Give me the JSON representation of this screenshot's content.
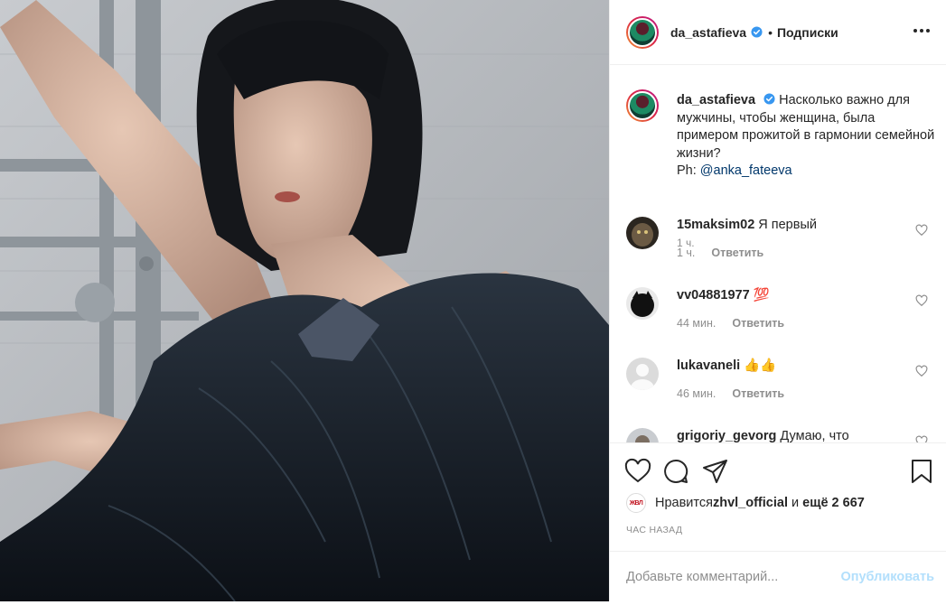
{
  "header": {
    "username": "da_astafieva",
    "separator": "•",
    "follow_label": "Подписки",
    "more_icon": "more-horizontal-icon"
  },
  "caption": {
    "username": "da_astafieva",
    "text": "Насколько важно для мужчины, чтобы женщина, была примером прожитой в гармонии семейной жизни?",
    "credit_prefix": "Ph: ",
    "credit_link": "@anka_fateeva",
    "time": "1 ч."
  },
  "comments": [
    {
      "username": "15maksim02",
      "text": "Я первый",
      "time": "1 ч.",
      "reply": "Ответить"
    },
    {
      "username": "vv04881977",
      "text": "💯",
      "time": "44 мин.",
      "reply": "Ответить"
    },
    {
      "username": "lukavaneli",
      "text": "👍👍",
      "time": "46 мин.",
      "reply": "Ответить"
    },
    {
      "username": "grigoriy_gevorg",
      "text": "Думаю, что",
      "time": "",
      "reply": ""
    }
  ],
  "likes": {
    "prefix": "Нравится ",
    "user": "zhvl_official",
    "middle": " и ",
    "others": "ещё 2 667",
    "liker_badge": "ЖВЛ"
  },
  "post_time": "ЧАС НАЗАД",
  "add_comment": {
    "placeholder": "Добавьте комментарий...",
    "publish_label": "Опубликовать"
  },
  "colors": {
    "verified": "#3897f0",
    "link": "#00376b",
    "publish_disabled": "#b2dffc",
    "muted": "#8e8e8e"
  }
}
